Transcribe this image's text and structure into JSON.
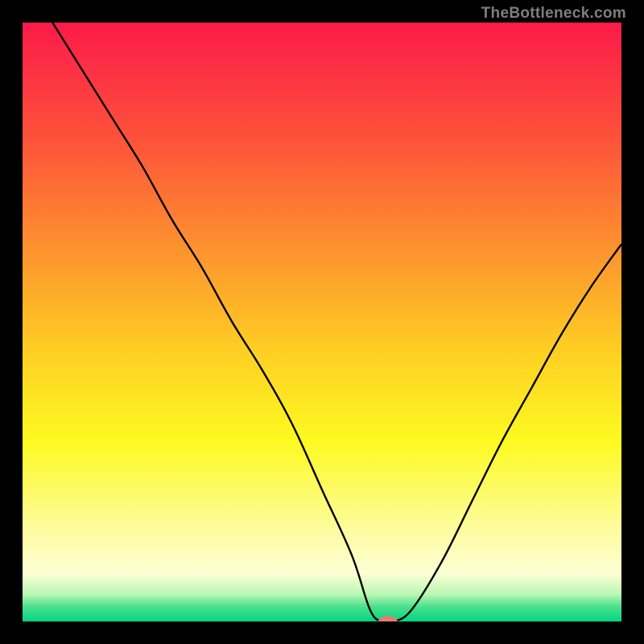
{
  "watermark": "TheBottleneck.com",
  "chart_data": {
    "type": "line",
    "title": "",
    "xlabel": "",
    "ylabel": "",
    "xlim": [
      0,
      100
    ],
    "ylim": [
      0,
      100
    ],
    "grid": false,
    "legend": false,
    "background_gradient": {
      "stops": [
        {
          "offset": 0.0,
          "color": "#fc1a49"
        },
        {
          "offset": 0.2,
          "color": "#fd543a"
        },
        {
          "offset": 0.4,
          "color": "#fd9a2d"
        },
        {
          "offset": 0.55,
          "color": "#fecf23"
        },
        {
          "offset": 0.7,
          "color": "#fdfa21"
        },
        {
          "offset": 0.85,
          "color": "#fdfca1"
        },
        {
          "offset": 0.92,
          "color": "#fdfed5"
        },
        {
          "offset": 0.955,
          "color": "#b8f7b3"
        },
        {
          "offset": 0.975,
          "color": "#4de08d"
        },
        {
          "offset": 1.0,
          "color": "#00d67e"
        }
      ]
    },
    "series": [
      {
        "name": "bottleneck-curve",
        "color": "#000000",
        "x": [
          5,
          10,
          15,
          20,
          25,
          30,
          35,
          40,
          45,
          50,
          55,
          58,
          60,
          62,
          65,
          70,
          75,
          80,
          85,
          90,
          95,
          100
        ],
        "y": [
          100,
          92,
          84,
          76,
          67,
          59,
          50,
          42,
          33,
          22,
          11,
          2,
          0,
          0,
          2,
          10,
          20,
          30,
          39,
          48,
          56,
          63
        ]
      }
    ],
    "marker": {
      "name": "optimal-point",
      "x": 61,
      "y": 0,
      "color": "#e77c74",
      "rx": 12,
      "ry": 7
    }
  }
}
